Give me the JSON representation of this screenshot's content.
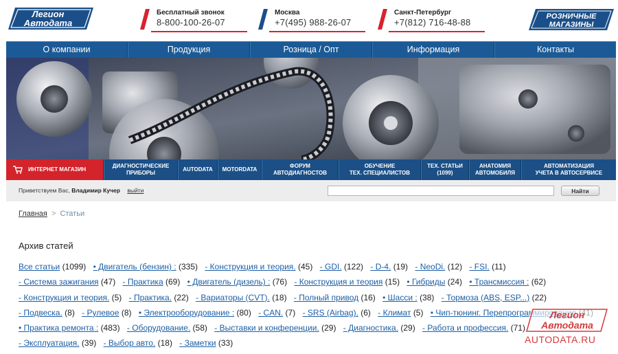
{
  "header": {
    "logo": {
      "line1": "Легион",
      "line2": "Автодата"
    },
    "contacts": [
      {
        "label": "Бесплатный звонок",
        "phone": "8-800-100-26-07"
      },
      {
        "label": "Москва",
        "phone": "+7(495) 988-26-07"
      },
      {
        "label": "Санкт-Петербург",
        "phone": "+7(812) 716-48-88"
      }
    ],
    "retail": {
      "line1": "РОЗНИЧНЫЕ",
      "line2": "МАГАЗИНЫ"
    }
  },
  "main_nav": [
    "О компании",
    "Продукция",
    "Розница / Опт",
    "Информация",
    "Контакты"
  ],
  "sub_nav": {
    "shop": "ИНТЕРНЕТ МАГАЗИН",
    "items": [
      {
        "l1": "ДИАГНОСТИЧЕСКИЕ",
        "l2": "ПРИБОРЫ"
      },
      {
        "l1": "AUTODATA",
        "l2": ""
      },
      {
        "l1": "MOTORDATA",
        "l2": ""
      },
      {
        "l1": "ФОРУМ",
        "l2": "АВТОДИАГНОСТОВ"
      },
      {
        "l1": "ОБУЧЕНИЕ",
        "l2": "ТЕХ. СПЕЦИАЛИСТОВ"
      },
      {
        "l1": "ТЕХ. СТАТЬИ",
        "l2": "(1099)"
      },
      {
        "l1": "АНАТОМИЯ",
        "l2": "АВТОМОБИЛЯ"
      },
      {
        "l1": "АВТОМАТИЗАЦИЯ",
        "l2": "УЧЕТА В АВТОСЕРВИСЕ"
      }
    ]
  },
  "greeting": {
    "prefix": "Приветствуем Вас,",
    "user": "Владимир Кучер",
    "logout": "выйти"
  },
  "search": {
    "button": "Найти",
    "value": ""
  },
  "breadcrumb": {
    "home": "Главная",
    "sep": ">",
    "current": "Статьи"
  },
  "page_title": "Архив статей",
  "tags": [
    {
      "name": "Все статьи",
      "count": "(1099)"
    },
    {
      "name": "• Двигатель (бензин) :",
      "count": "(335)"
    },
    {
      "name": "- Конструкция и теория.",
      "count": "(45)"
    },
    {
      "name": "- GDI.",
      "count": "(122)"
    },
    {
      "name": "- D-4.",
      "count": "(19)"
    },
    {
      "name": "- NeoDi.",
      "count": "(12)"
    },
    {
      "name": "- FSI.",
      "count": "(11)"
    },
    {
      "name": "- Система зажигания",
      "count": "(47)"
    },
    {
      "name": "- Практика",
      "count": "(69)"
    },
    {
      "name": "• Двигатель (дизель) :",
      "count": "(76)"
    },
    {
      "name": "- Конструкция и теория",
      "count": "(15)"
    },
    {
      "name": "• Гибриды",
      "count": "(24)"
    },
    {
      "name": "• Трансмиссия :",
      "count": "(62)"
    },
    {
      "name": "- Конструкция и теория.",
      "count": "(5)"
    },
    {
      "name": "- Практика.",
      "count": "(22)"
    },
    {
      "name": "- Вариаторы (CVT).",
      "count": "(18)"
    },
    {
      "name": "- Полный привод",
      "count": "(16)"
    },
    {
      "name": "• Шасси :",
      "count": "(38)"
    },
    {
      "name": "- Тормоза (ABS, ESP...)",
      "count": "(22)"
    },
    {
      "name": "- Подвеска.",
      "count": "(8)"
    },
    {
      "name": "- Рулевое",
      "count": "(8)"
    },
    {
      "name": "• Электрооборудование :",
      "count": "(80)"
    },
    {
      "name": "- CAN.",
      "count": "(7)"
    },
    {
      "name": "- SRS (Airbag).",
      "count": "(6)"
    },
    {
      "name": "- Климат",
      "count": "(5)"
    },
    {
      "name": "• Чип-тюнинг. Перепрограммирование",
      "count": "(41)"
    },
    {
      "name": "• Практика ремонта :",
      "count": "(483)"
    },
    {
      "name": "- Оборудование.",
      "count": "(58)"
    },
    {
      "name": "- Выставки и конференции.",
      "count": "(29)"
    },
    {
      "name": "- Диагностика.",
      "count": "(29)"
    },
    {
      "name": "- Работа и профессия.",
      "count": "(71)"
    },
    {
      "name": "- Эксплуатация.",
      "count": "(39)"
    },
    {
      "name": "- Выбор авто.",
      "count": "(18)"
    },
    {
      "name": "- Заметки",
      "count": "(33)"
    }
  ],
  "watermark": {
    "line1": "Легион",
    "line2": "Автодата",
    "url": "AUTODATA.RU"
  },
  "colors": {
    "nav_blue": "#1b5a96",
    "brand_red": "#d3232b",
    "link_blue": "#1c5fa5"
  }
}
